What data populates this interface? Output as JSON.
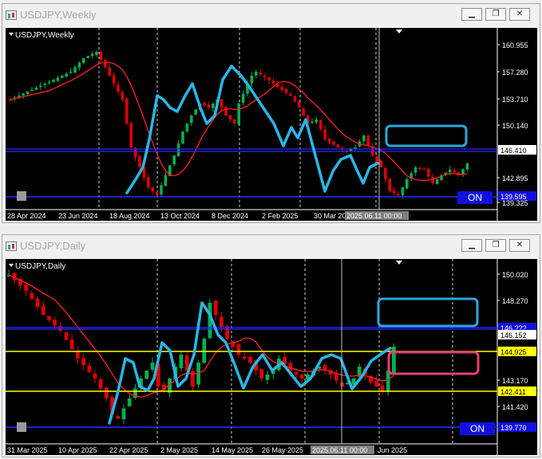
{
  "windows": {
    "top": {
      "title": "USDJPY,Weekly",
      "chart_label": "USDJPY,Weekly",
      "price_labels": [
        "160.955",
        "157.280",
        "153.710",
        "150.140",
        "146.410",
        "142.895",
        "139.595",
        "139.325"
      ],
      "time_labels": [
        "28 Apr 2024",
        "23 Jun 2024",
        "18 Aug 2024",
        "13 Oct 2024",
        "8 Dec 2024",
        "2 Feb 2025",
        "30 Mar 20",
        "2025.06.11 00:00"
      ],
      "on_label": "ON"
    },
    "bottom": {
      "title": "USDJPY,Daily",
      "chart_label": "USDJPY,Daily",
      "price_labels": [
        "150.020",
        "148.270",
        "146.???",
        "146.152",
        "144.925",
        "143.170",
        "142.411",
        "141.420",
        "139.770"
      ],
      "time_labels": [
        "31 Mar 2025",
        "10 Apr 2025",
        "22 Apr 2025",
        "2 May 2025",
        "14 May 2025",
        "26 May 2025",
        "2025.06.11 00:00",
        "Jun 2025"
      ],
      "on_label": "ON"
    }
  },
  "controls": {
    "minimize": "▁",
    "restore": "❐",
    "close": "✕"
  },
  "colors": {
    "bull": "#00b050",
    "bear": "#e00000",
    "ma": "#ff2020",
    "zigzag": "#29b6e6",
    "hline_blue": "#2b2bff",
    "hline_yellow": "#ffff00",
    "zone_blue": "#29a8e0",
    "zone_pink": "#e83e6c",
    "on_bg": "#1010e0"
  }
}
